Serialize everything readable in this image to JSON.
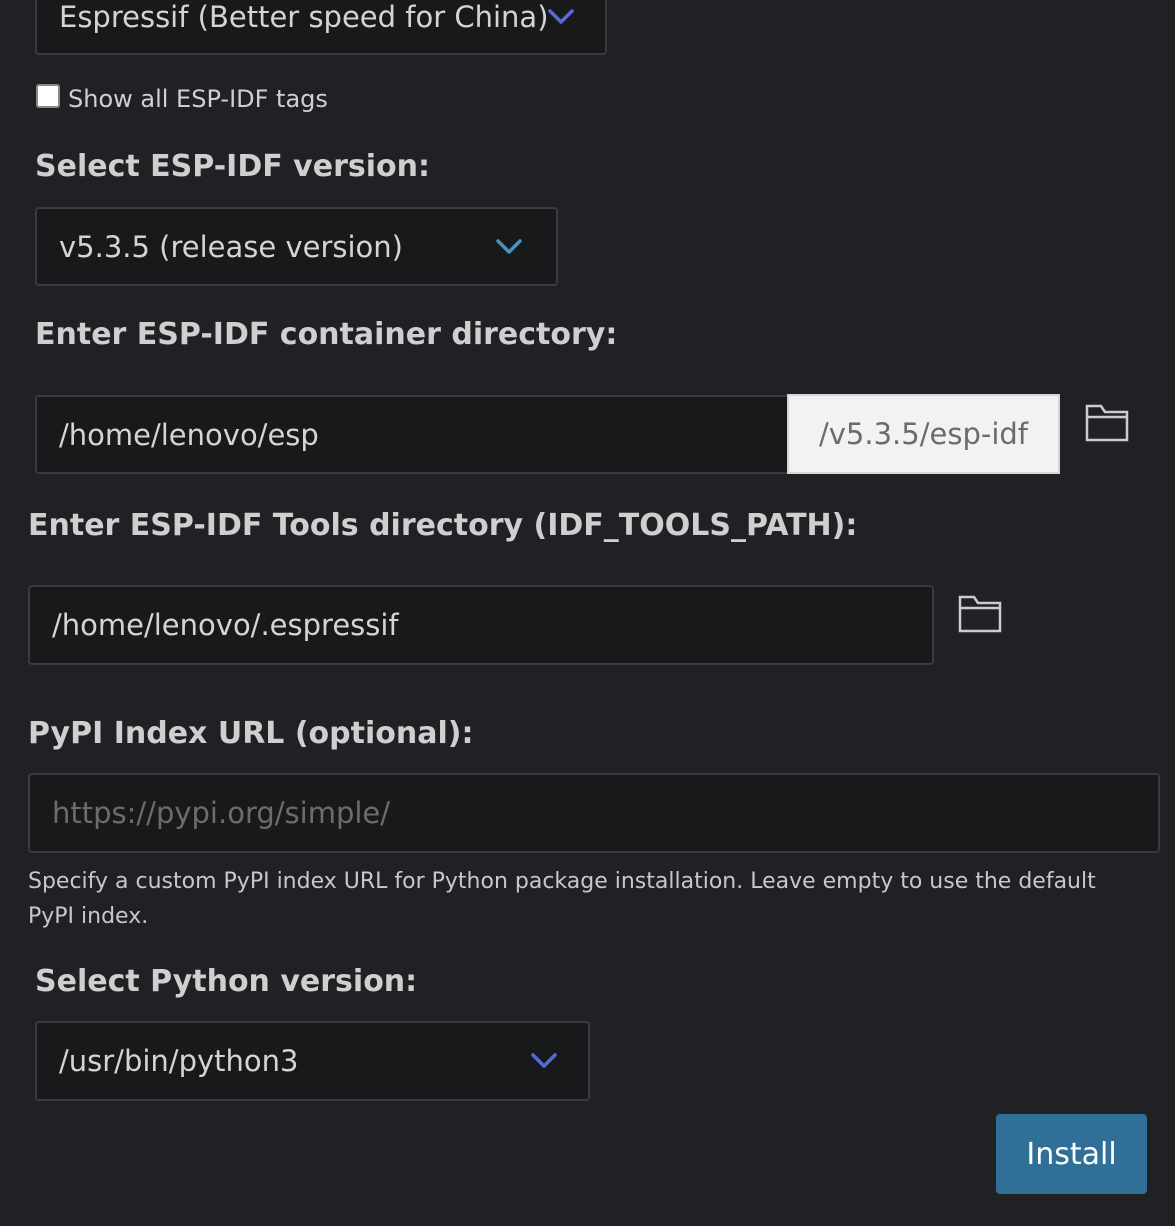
{
  "mirror_select": {
    "value": "Espressif (Better speed for China)",
    "chevron_color": "#5b6ad8"
  },
  "show_all_tags": {
    "label": "Show all ESP-IDF tags",
    "checked": false
  },
  "idf_version": {
    "label": "Select ESP-IDF version:",
    "value": "v5.3.5 (release version)",
    "chevron_color": "#4a90c0"
  },
  "container_dir": {
    "label": "Enter ESP-IDF container directory:",
    "value": "/home/lenovo/esp",
    "suffix": "/v5.3.5/esp-idf",
    "browse_icon": "folder-icon"
  },
  "tools_dir": {
    "label": "Enter ESP-IDF Tools directory (IDF_TOOLS_PATH):",
    "value": "/home/lenovo/.espressif",
    "browse_icon": "folder-icon"
  },
  "pypi": {
    "label": "PyPI Index URL (optional):",
    "value": "",
    "placeholder": "https://pypi.org/simple/",
    "help": "Specify a custom PyPI index URL for Python package installation. Leave empty to use the default PyPI index."
  },
  "python_version": {
    "label": "Select Python version:",
    "value": "/usr/bin/python3",
    "chevron_color": "#5b6ad8"
  },
  "install_button": {
    "label": "Install",
    "color": "#2f6f98"
  }
}
